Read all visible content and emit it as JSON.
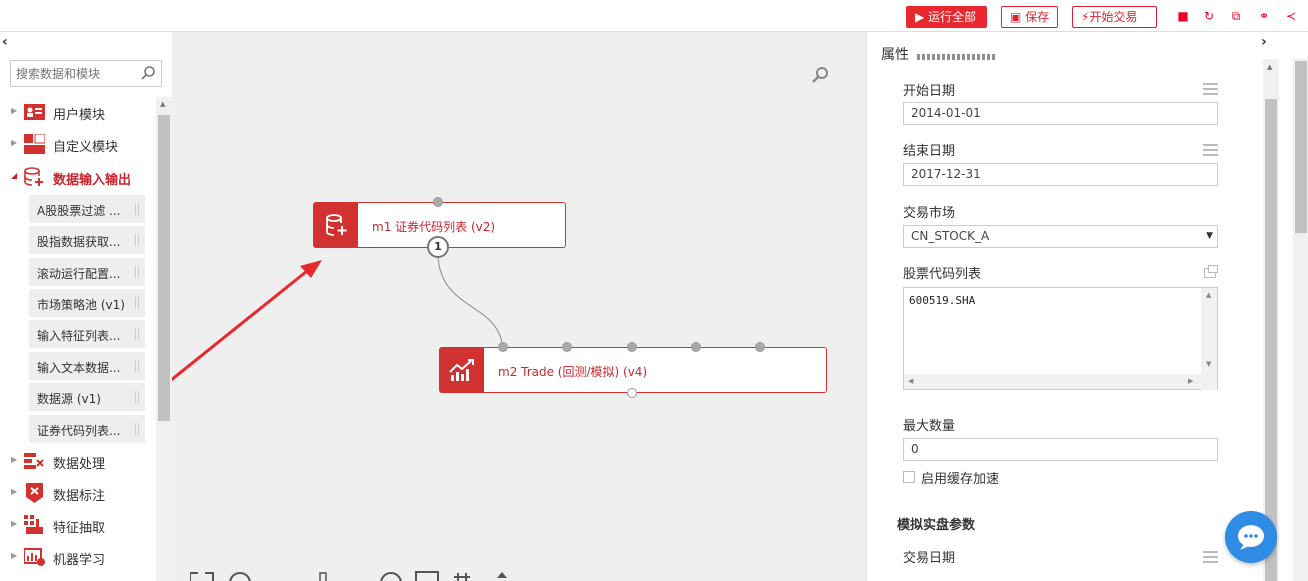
{
  "toolbar": {
    "run_all": "▶ 运行全部",
    "save": "保存",
    "start_trade": "开始交易",
    "icons": [
      "stop-icon",
      "refresh-icon",
      "copy-icon",
      "link-icon",
      "share-icon"
    ]
  },
  "left": {
    "collapse_glyph": "‹",
    "search_placeholder": "搜索数据和模块",
    "tree": [
      {
        "label": "用户模块",
        "icon": "user-module-icon",
        "expanded": false
      },
      {
        "label": "自定义模块",
        "icon": "custom-module-icon",
        "expanded": false
      },
      {
        "label": "数据输入输出",
        "icon": "data-io-icon",
        "expanded": true
      }
    ],
    "children": [
      "A股股票过滤 ...",
      "股指数据获取...",
      "滚动运行配置...",
      "市场策略池 (v1)",
      "输入特征列表...",
      "输入文本数据...",
      "数据源 (v1)",
      "证券代码列表..."
    ],
    "tree_after": [
      {
        "label": "数据处理",
        "icon": "data-process-icon"
      },
      {
        "label": "数据标注",
        "icon": "data-label-icon"
      },
      {
        "label": "特征抽取",
        "icon": "feature-extract-icon"
      },
      {
        "label": "机器学习",
        "icon": "machine-learning-icon"
      }
    ]
  },
  "canvas": {
    "node1": {
      "label": "m1 证券代码列表 (v2)",
      "badge": "1"
    },
    "node2": {
      "label": "m2 Trade (回测/模拟) (v4)"
    }
  },
  "right": {
    "collapse_glyph": "›",
    "title": "属性",
    "fields": {
      "start_date_label": "开始日期",
      "start_date_value": "2014-01-01",
      "end_date_label": "结束日期",
      "end_date_value": "2017-12-31",
      "market_label": "交易市场",
      "market_value": "CN_STOCK_A",
      "codes_label": "股票代码列表",
      "codes_value": "600519.SHA",
      "max_count_label": "最大数量",
      "max_count_value": "0",
      "cache_label": "启用缓存加速"
    },
    "section_title": "模拟实盘参数",
    "trade_date_label": "交易日期"
  },
  "colors": {
    "brand_red": "#d2322f",
    "chat_blue": "#2f8ce4",
    "arrow_red": "#e8272e"
  }
}
